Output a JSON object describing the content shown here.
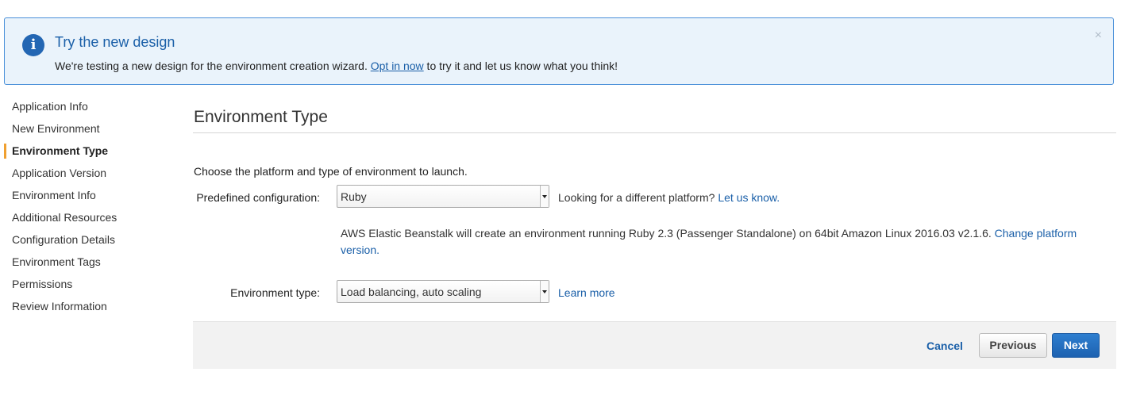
{
  "banner": {
    "title": "Try the new design",
    "text_before": "We're testing a new design for the environment creation wizard. ",
    "link": "Opt in now",
    "text_after": " to try it and let us know what you think!",
    "info_icon_glyph": "i",
    "close_glyph": "×"
  },
  "sidebar": {
    "items": [
      {
        "label": "Application Info"
      },
      {
        "label": "New Environment"
      },
      {
        "label": "Environment Type",
        "active": true
      },
      {
        "label": "Application Version"
      },
      {
        "label": "Environment Info"
      },
      {
        "label": "Additional Resources"
      },
      {
        "label": "Configuration Details"
      },
      {
        "label": "Environment Tags"
      },
      {
        "label": "Permissions"
      },
      {
        "label": "Review Information"
      }
    ]
  },
  "main": {
    "title": "Environment Type",
    "intro": "Choose the platform and type of environment to launch.",
    "predefined": {
      "label": "Predefined configuration:",
      "value": "Ruby",
      "helper_text": "Looking for a different platform? ",
      "helper_link": "Let us know."
    },
    "description": {
      "text": "AWS Elastic Beanstalk will create an environment running Ruby 2.3 (Passenger Standalone) on 64bit Amazon Linux 2016.03 v2.1.6. ",
      "link": "Change platform version."
    },
    "env_type": {
      "label": "Environment type:",
      "value": "Load balancing, auto scaling",
      "link": "Learn more"
    }
  },
  "footer": {
    "cancel": "Cancel",
    "previous": "Previous",
    "next": "Next"
  },
  "colors": {
    "accent": "#1a5fa8",
    "active_marker": "#f0a030",
    "banner_bg": "#eaf3fb",
    "next_button": "#1d62b0"
  }
}
